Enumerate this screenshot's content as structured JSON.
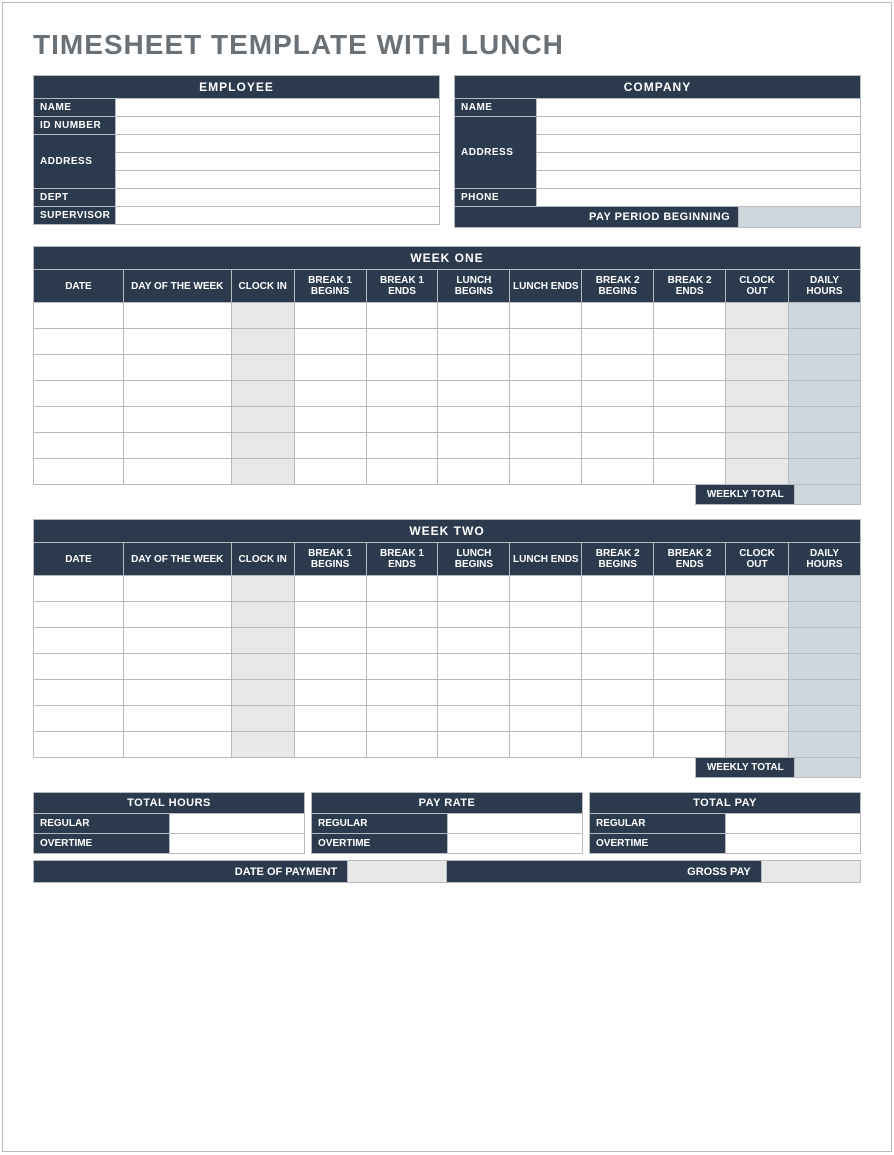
{
  "title": "TIMESHEET TEMPLATE WITH LUNCH",
  "employee": {
    "header": "EMPLOYEE",
    "labels": {
      "name": "NAME",
      "id": "ID NUMBER",
      "address": "ADDRESS",
      "dept": "DEPT",
      "supervisor": "SUPERVISOR"
    },
    "values": {
      "name": "",
      "id": "",
      "address1": "",
      "address2": "",
      "address3": "",
      "dept": "",
      "supervisor": ""
    }
  },
  "company": {
    "header": "COMPANY",
    "labels": {
      "name": "NAME",
      "address": "ADDRESS",
      "phone": "PHONE"
    },
    "values": {
      "name": "",
      "address1": "",
      "address2": "",
      "address3": "",
      "address4": "",
      "phone": ""
    },
    "pay_period_label": "PAY PERIOD BEGINNING",
    "pay_period_value": ""
  },
  "week_columns": [
    "DATE",
    "DAY OF THE WEEK",
    "CLOCK IN",
    "BREAK 1 BEGINS",
    "BREAK 1 ENDS",
    "LUNCH BEGINS",
    "LUNCH ENDS",
    "BREAK 2 BEGINS",
    "BREAK 2 ENDS",
    "CLOCK OUT",
    "DAILY HOURS"
  ],
  "week_one": {
    "banner": "WEEK ONE",
    "rows": [
      {},
      {},
      {},
      {},
      {},
      {},
      {}
    ],
    "weekly_total_label": "WEEKLY TOTAL",
    "weekly_total_value": ""
  },
  "week_two": {
    "banner": "WEEK TWO",
    "rows": [
      {},
      {},
      {},
      {},
      {},
      {},
      {}
    ],
    "weekly_total_label": "WEEKLY TOTAL",
    "weekly_total_value": ""
  },
  "summary": {
    "total_hours": {
      "header": "TOTAL HOURS",
      "regular_label": "REGULAR",
      "overtime_label": "OVERTIME",
      "regular": "",
      "overtime": ""
    },
    "pay_rate": {
      "header": "PAY RATE",
      "regular_label": "REGULAR",
      "overtime_label": "OVERTIME",
      "regular": "",
      "overtime": ""
    },
    "total_pay": {
      "header": "TOTAL PAY",
      "regular_label": "REGULAR",
      "overtime_label": "OVERTIME",
      "regular": "",
      "overtime": ""
    }
  },
  "footer": {
    "date_of_payment_label": "DATE OF PAYMENT",
    "date_of_payment_value": "",
    "gross_pay_label": "GROSS PAY",
    "gross_pay_value": ""
  }
}
